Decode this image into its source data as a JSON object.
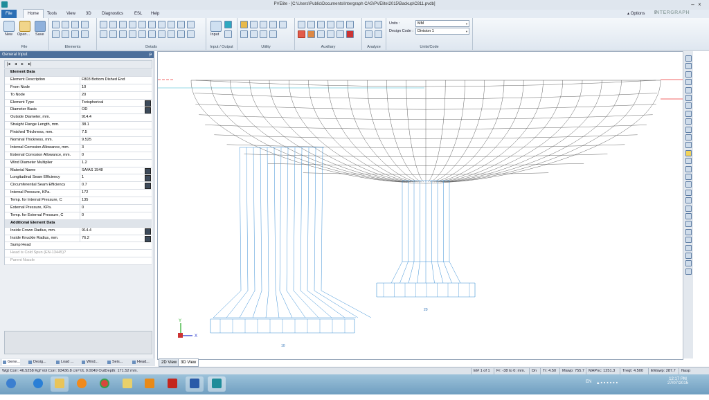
{
  "window": {
    "title": "PVElite - [C:\\Users\\Public\\Documents\\Intergraph CAS\\PVElite\\2015\\Backup\\C811.pvdb]"
  },
  "menu": {
    "tabs": [
      "File",
      "Home",
      "Tools",
      "View",
      "3D",
      "Diagnostics",
      "ESL",
      "Help"
    ],
    "options_label": "Options",
    "logo": "INTERGRAPH"
  },
  "ribbon": {
    "file_group": {
      "new_label": "New",
      "open_label": "Open...",
      "save_label": "Save",
      "group_label": "File"
    },
    "elements_group_label": "Elements",
    "details_group_label": "Details",
    "io_group": {
      "input_label": "Input",
      "group_label": "Input / Output"
    },
    "utility_group_label": "Utility",
    "auxiliary_group_label": "Auxiliary",
    "analyze_group_label": "Analyze",
    "units": {
      "units_label": "Units :",
      "units_value": "MM",
      "design_code_label": "Design Code :",
      "design_code_value": "Division 1",
      "group_label": "Units/Code"
    }
  },
  "panel": {
    "title": "General Input",
    "rows": [
      {
        "label": "Element Data",
        "value": "",
        "type": "header"
      },
      {
        "label": "Element Description",
        "value": "F803 Bottom Dished End"
      },
      {
        "label": "From Node",
        "value": "10"
      },
      {
        "label": "To Node",
        "value": "20"
      },
      {
        "label": "Element Type",
        "value": "Torispherical",
        "button": true
      },
      {
        "label": "Diameter Basis",
        "value": "OD",
        "button": true
      },
      {
        "label": "Outside Diameter, mm.",
        "value": "914.4"
      },
      {
        "label": "Straight Flange Length, mm.",
        "value": "38.1"
      },
      {
        "label": "Finished Thickness, mm.",
        "value": "7.5"
      },
      {
        "label": "Nominal Thickness, mm.",
        "value": "9.525"
      },
      {
        "label": "Internal Corrosion Allowance, mm.",
        "value": "3"
      },
      {
        "label": "External Corrosion Allowance, mm.",
        "value": "0"
      },
      {
        "label": "Wind Diameter Multiplier",
        "value": "1.2"
      },
      {
        "label": "Material Name",
        "value": "SA/AS 1548",
        "button": true
      },
      {
        "label": "Longitudinal Seam Efficiency",
        "value": "1",
        "button": true
      },
      {
        "label": "Circumferential Seam Efficiency",
        "value": "0.7",
        "button": true
      },
      {
        "label": "Internal Pressure, KPa.",
        "value": "172"
      },
      {
        "label": "Temp. for Internal Pressure, C",
        "value": "135"
      },
      {
        "label": "External Pressure, KPa.",
        "value": "0"
      },
      {
        "label": "Temp. for External Pressure, C",
        "value": "0"
      },
      {
        "label": "Additional Element Data",
        "value": "",
        "type": "header"
      },
      {
        "label": "Inside Crown Radius, mm.",
        "value": "914.4",
        "button": true
      },
      {
        "label": "Inside Knuckle Radius, mm.",
        "value": "76.2",
        "button": true
      },
      {
        "label": "Sump Head",
        "value": ""
      },
      {
        "label": "Head is Cold Spun (EN-13445)?",
        "value": "",
        "type": "disabled"
      },
      {
        "label": "Parent Nozzle",
        "value": "",
        "type": "disabled"
      }
    ]
  },
  "lower_tabs": [
    "Gene...",
    "Desig...",
    "Load ...",
    "Wind...",
    "Seis...",
    "Head..."
  ],
  "view_tabs": [
    "2D View",
    "3D View"
  ],
  "viewport": {
    "node_labels": [
      "10",
      "20"
    ],
    "axis_labels": {
      "y": "Y",
      "x": "X"
    }
  },
  "status": {
    "left": "Wgt Corr: 46.5258 Kgf  Vol Corr: 93436.8 cm³  t/L 0.0049  OutDepth: 171.52 mm.",
    "cells": [
      "El# 1 of 1",
      "Fr: -38 to 0: mm.",
      "Dn",
      "Tr: 4.50",
      "Mawp: 755.7",
      "MAPnc: 1251.3",
      "Treqt: 4.500",
      "EMawp: 287.7",
      "Nasp"
    ]
  },
  "taskbar": {
    "apps": [
      "start",
      "ie",
      "explorer",
      "media",
      "chrome",
      "folder",
      "outlook",
      "pdf",
      "word",
      "pvelite"
    ],
    "lang": "EN",
    "time": "12:17 PM",
    "date": "27/07/2015"
  }
}
